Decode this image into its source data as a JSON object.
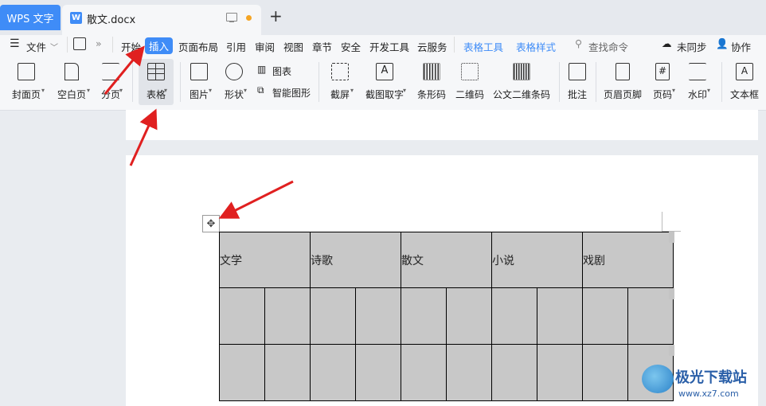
{
  "titlebar": {
    "app_tab": "WPS 文字",
    "doc_tab": "散文.docx",
    "new_tab": "+"
  },
  "menubar": {
    "file": "文件",
    "items": [
      "开始",
      "插入",
      "页面布局",
      "引用",
      "审阅",
      "视图",
      "章节",
      "安全",
      "开发工具",
      "云服务"
    ],
    "table_tools": "表格工具",
    "table_style": "表格样式",
    "search": "查找命令",
    "sync": "未同步",
    "collab": "协作"
  },
  "ribbon": {
    "cover": "封面页",
    "blank": "空白页",
    "pagebreak": "分页",
    "table": "表格",
    "picture": "图片",
    "shape": "形状",
    "chart": "图表",
    "smartart": "智能图形",
    "screenshot": "截屏",
    "ocr": "截图取字",
    "barcode": "条形码",
    "qrcode": "二维码",
    "doc_barcode": "公文二维条码",
    "comment": "批注",
    "header_footer": "页眉页脚",
    "page_number": "页码",
    "watermark": "水印",
    "textbox": "文本框"
  },
  "table": {
    "headers": [
      "文学",
      "诗歌",
      "散文",
      "小说",
      "戏剧"
    ]
  },
  "watermark": {
    "name": "极光下载站",
    "url": "www.xz7.com"
  },
  "colors": {
    "accent": "#3f8cf7",
    "arrow": "#e02020",
    "table_fill": "#c8c8c8"
  }
}
